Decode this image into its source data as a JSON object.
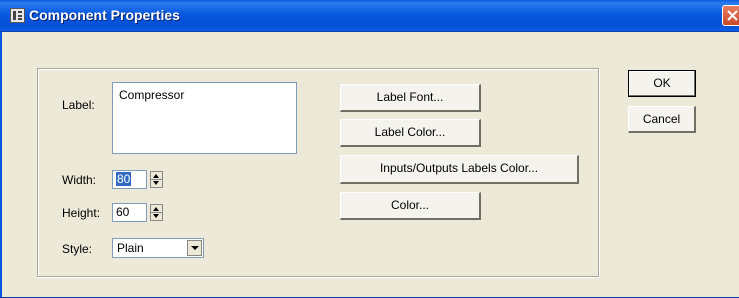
{
  "window": {
    "title": "Component Properties",
    "icon": "component-properties-icon"
  },
  "form": {
    "label_caption": "Label:",
    "label_value": "Compressor",
    "width_caption": "Width:",
    "width_value": "80",
    "height_caption": "Height:",
    "height_value": "60",
    "style_caption": "Style:",
    "style_value": "Plain"
  },
  "buttons": {
    "label_font": "Label Font...",
    "label_color": "Label Color...",
    "io_labels_color": "Inputs/Outputs Labels Color...",
    "color": "Color...",
    "ok": "OK",
    "cancel": "Cancel"
  },
  "colors": {
    "titlebar": "#0858DE",
    "dialog_bg": "#ECE9D8",
    "selection": "#316AC5",
    "close": "#C94A28"
  }
}
